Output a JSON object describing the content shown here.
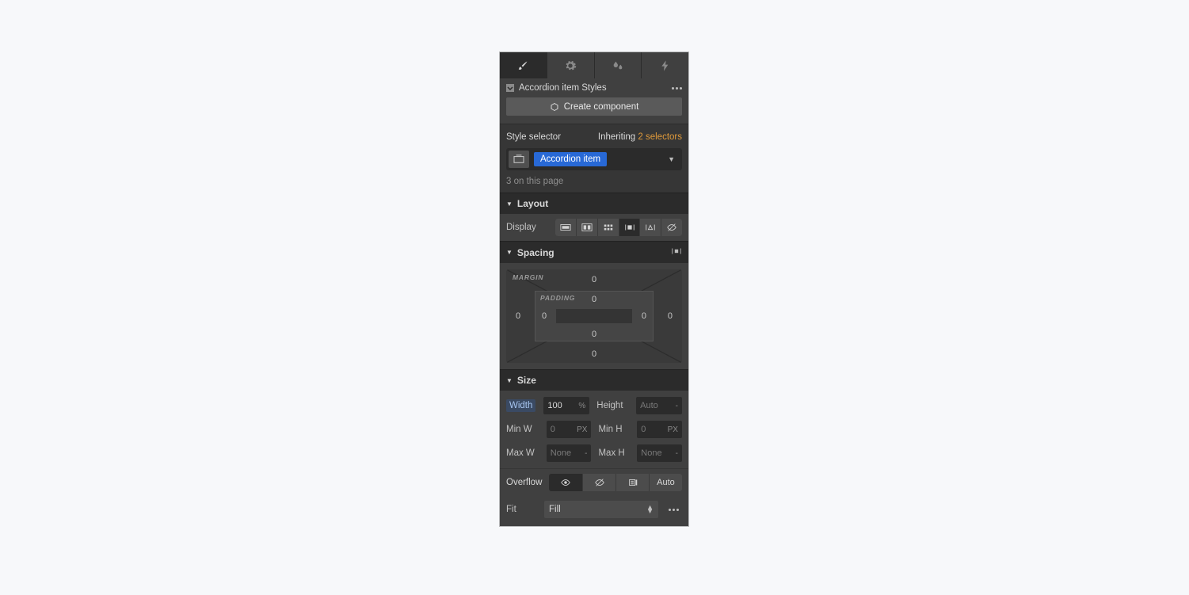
{
  "tabs": {
    "active": 0
  },
  "header": {
    "title": "Accordion item Styles",
    "create_label": "Create component"
  },
  "selector": {
    "label": "Style selector",
    "inherit_text": "Inheriting ",
    "inherit_count": "2 selectors",
    "tag": "Accordion item",
    "page_count": "3 on this page"
  },
  "sections": {
    "layout": "Layout",
    "spacing": "Spacing",
    "size": "Size"
  },
  "display": {
    "label": "Display"
  },
  "spacing": {
    "margin_label": "MARGIN",
    "padding_label": "PADDING",
    "margin": {
      "top": "0",
      "right": "0",
      "bottom": "0",
      "left": "0"
    },
    "padding": {
      "top": "0",
      "right": "0",
      "bottom": "0",
      "left": "0"
    }
  },
  "size": {
    "width": {
      "label": "Width",
      "value": "100",
      "unit": "%"
    },
    "height": {
      "label": "Height",
      "placeholder": "Auto",
      "unit": "-"
    },
    "minw": {
      "label": "Min W",
      "placeholder": "0",
      "unit": "PX"
    },
    "minh": {
      "label": "Min H",
      "placeholder": "0",
      "unit": "PX"
    },
    "maxw": {
      "label": "Max W",
      "placeholder": "None",
      "unit": "-"
    },
    "maxh": {
      "label": "Max H",
      "placeholder": "None",
      "unit": "-"
    }
  },
  "overflow": {
    "label": "Overflow",
    "auto": "Auto"
  },
  "fit": {
    "label": "Fit",
    "value": "Fill"
  }
}
